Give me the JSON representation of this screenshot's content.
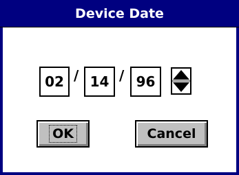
{
  "dialog": {
    "title": "Device Date",
    "month": "02",
    "separator1": "/",
    "day": "14",
    "separator2": "/",
    "year": "96",
    "ok_label": "OK",
    "cancel_label": "Cancel"
  },
  "icons": {
    "spinner": "up-down-spinner-icon"
  },
  "colors": {
    "title_bar": "#000080",
    "button_face": "#c0c0c0",
    "background": "#ffffff"
  }
}
